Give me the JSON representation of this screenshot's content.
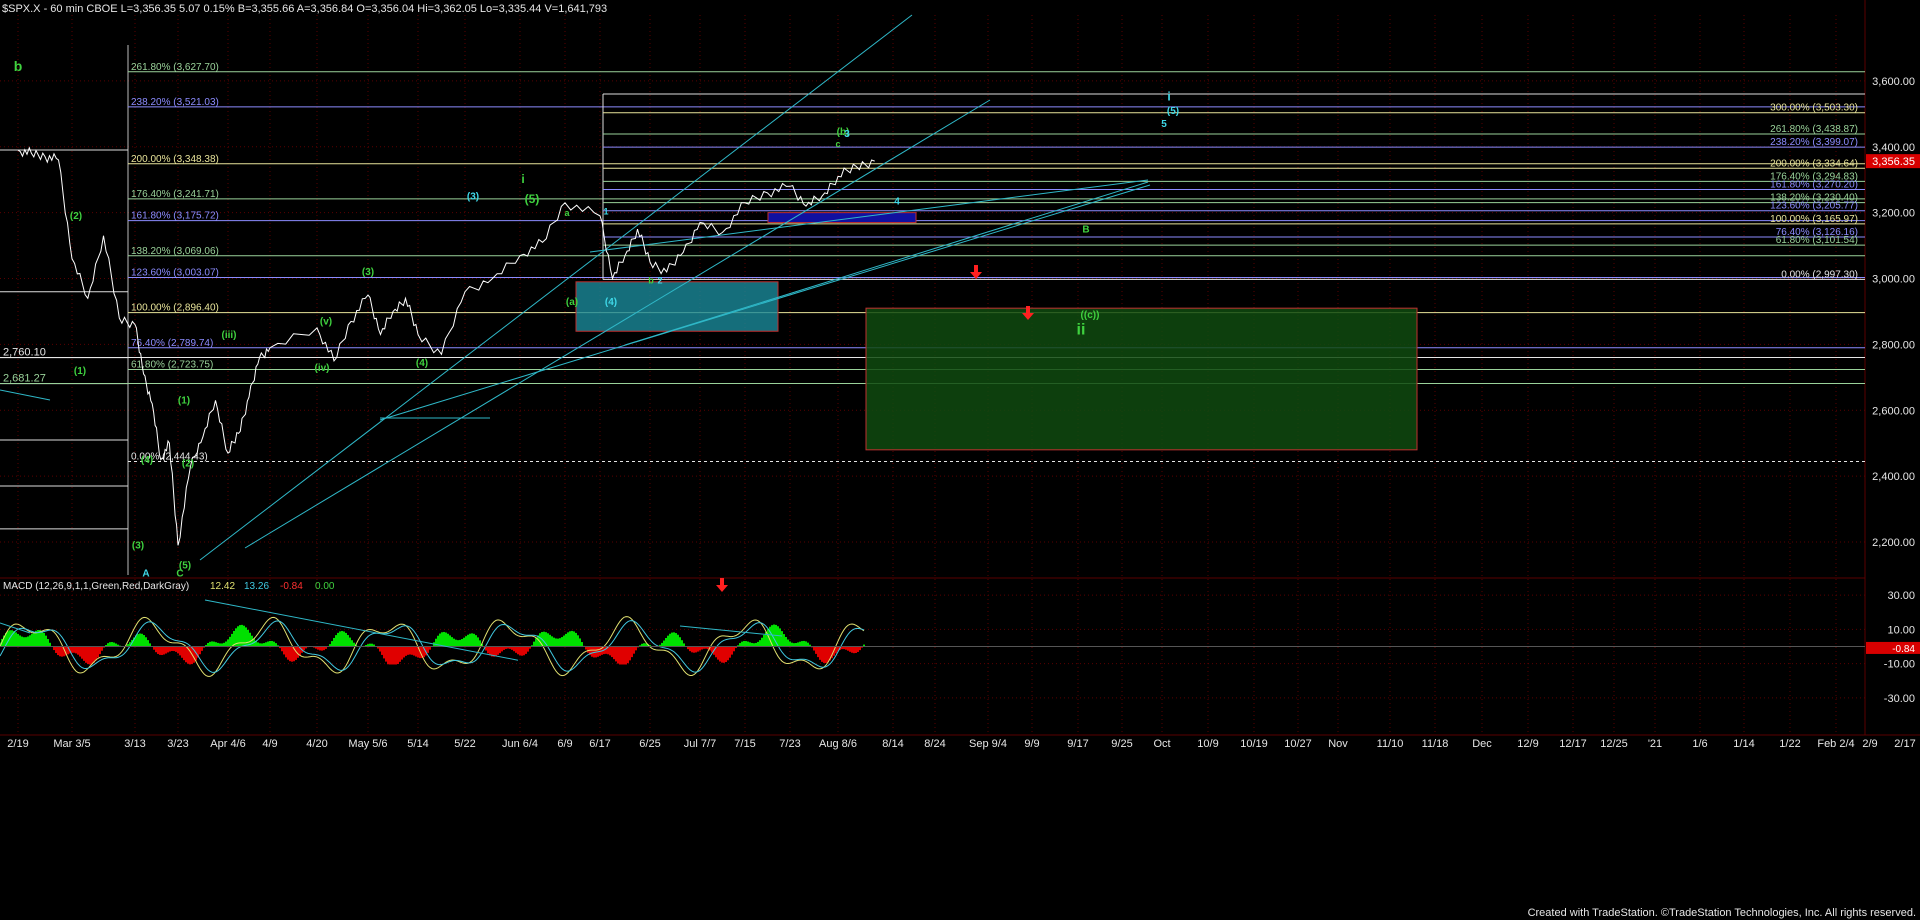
{
  "header": {
    "title": "$SPX.X - 60 min  CBOE  L=3,356.35  5.07  0.15%  B=3,355.66  A=3,356.84  O=3,356.04  Hi=3,362.05  Lo=3,335.44  V=1,641,793"
  },
  "footer": {
    "credit": "Created with TradeStation. ©TradeStation Technologies, Inc. All rights reserved."
  },
  "colors": {
    "background": "#000000",
    "grid": "#5a0000",
    "price": "#ffffff",
    "channel": "#2fb8c8",
    "fib_white": "#e6e6e6",
    "fib_yellow": "#e8e49a",
    "fib_blue": "#8c8cff",
    "fib_green": "#9ad29a",
    "label_green": "#3fd23f",
    "label_cyan": "#3fd8e8",
    "arrow_red": "#ff2020",
    "macd_pos": "#00e000",
    "macd_neg": "#e00000",
    "macd_line": "#e0e070",
    "macd_signal": "#40c8e0",
    "current_price_bg": "#d80000"
  },
  "chart_data": {
    "type": "line",
    "title": "$SPX.X - 60 min",
    "price_axis": {
      "ylim": [
        2100,
        3800
      ],
      "ticks": [
        "3,600.00",
        "3,400.00",
        "3,200.00",
        "3,000.00",
        "2,800.00",
        "2,600.00",
        "2,400.00",
        "2,200.00"
      ],
      "tick_values": [
        3600,
        3400,
        3200,
        3000,
        2800,
        2600,
        2400,
        2200
      ],
      "current_price_label": "3,356.35",
      "current_price": 3356.35
    },
    "x_axis": {
      "labels": [
        "2/19",
        "Mar 3/5",
        "3/13",
        "3/23",
        "Apr 4/6",
        "4/9",
        "4/20",
        "May 5/6",
        "5/14",
        "5/22",
        "Jun 6/4",
        "6/9",
        "6/17",
        "6/25",
        "Jul 7/7",
        "7/15",
        "7/23",
        "Aug 8/6",
        "8/14",
        "8/24",
        "Sep 9/4",
        "9/9",
        "9/17",
        "9/25",
        "Oct",
        "10/9",
        "10/19",
        "10/27",
        "Nov",
        "11/10",
        "11/18",
        "Dec",
        "12/9",
        "12/17",
        "12/25",
        "'21",
        "1/6",
        "1/14",
        "1/22",
        "Feb 2/4",
        "2/9",
        "2/17"
      ]
    },
    "price_series": {
      "name": "SPX 60 min",
      "points": [
        [
          "2/19",
          3390
        ],
        [
          "2/19",
          3380
        ],
        [
          "2/19",
          3370
        ],
        [
          "2/19",
          3360
        ],
        [
          "Mar 3/5",
          3060
        ],
        [
          "Mar 3/5",
          2940
        ],
        [
          "Mar 3/5",
          3130
        ],
        [
          "Mar 3/5",
          2880
        ],
        [
          "3/13",
          2860
        ],
        [
          "3/13",
          2710
        ],
        [
          "3/13",
          2620
        ],
        [
          "3/13",
          2450
        ],
        [
          "3/13",
          2500
        ],
        [
          "3/23",
          2190
        ],
        [
          "3/23",
          2430
        ],
        [
          "3/23",
          2520
        ],
        [
          "3/23",
          2630
        ],
        [
          "Apr 4/6",
          2470
        ],
        [
          "Apr 4/6",
          2530
        ],
        [
          "Apr 4/6",
          2640
        ],
        [
          "Apr 4/6",
          2760
        ],
        [
          "4/9",
          2790
        ],
        [
          "4/20",
          2850
        ],
        [
          "4/20",
          2750
        ],
        [
          "4/20",
          2870
        ],
        [
          "May 5/6",
          2950
        ],
        [
          "May 5/6",
          2830
        ],
        [
          "May 5/6",
          2900
        ],
        [
          "May 5/6",
          2940
        ],
        [
          "5/14",
          2830
        ],
        [
          "5/14",
          2770
        ],
        [
          "5/22",
          2960
        ],
        [
          "5/22",
          3000
        ],
        [
          "Jun 6/4",
          3070
        ],
        [
          "Jun 6/4",
          3110
        ],
        [
          "6/9",
          3230
        ],
        [
          "6/17",
          3190
        ],
        [
          "6/17",
          3000
        ],
        [
          "6/17",
          3070
        ],
        [
          "6/17",
          3150
        ],
        [
          "6/25",
          3050
        ],
        [
          "6/25",
          3020
        ],
        [
          "6/25",
          3080
        ],
        [
          "Jul 7/7",
          3170
        ],
        [
          "Jul 7/7",
          3140
        ],
        [
          "7/15",
          3230
        ],
        [
          "7/15",
          3260
        ],
        [
          "7/23",
          3280
        ],
        [
          "7/23",
          3220
        ],
        [
          "7/23",
          3250
        ],
        [
          "Aug 8/6",
          3310
        ],
        [
          "Aug 8/6",
          3340
        ],
        [
          "Aug 8/6",
          3356.35
        ]
      ]
    },
    "fib_left": [
      {
        "label": "261.80% (3,627.70)",
        "value": 3627.7,
        "color": "#9ad29a"
      },
      {
        "label": "238.20% (3,521.03)",
        "value": 3521.03,
        "color": "#8c8cff"
      },
      {
        "label": "200.00% (3,348.38)",
        "value": 3348.38,
        "color": "#e8e49a"
      },
      {
        "label": "176.40% (3,241.71)",
        "value": 3241.71,
        "color": "#9ad29a"
      },
      {
        "label": "161.80% (3,175.72)",
        "value": 3175.72,
        "color": "#8c8cff"
      },
      {
        "label": "138.20% (3,069.06)",
        "value": 3069.06,
        "color": "#9ad29a"
      },
      {
        "label": "123.60% (3,003.07)",
        "value": 3003.07,
        "color": "#8c8cff"
      },
      {
        "label": "100.00% (2,896.40)",
        "value": 2896.4,
        "color": "#e8e49a"
      },
      {
        "label": "76.40% (2,789.74)",
        "value": 2789.74,
        "color": "#8c8cff"
      },
      {
        "label": "61.80% (2,723.75)",
        "value": 2723.75,
        "color": "#9ad29a"
      },
      {
        "label": "0.00% (2,444.43)",
        "value": 2444.43,
        "color": "#e6e6e6"
      }
    ],
    "fib_right": [
      {
        "label": "300.00% (3,503.30)",
        "value": 3503.3,
        "color": "#e8e49a"
      },
      {
        "label": "261.80% (3,438.87)",
        "value": 3438.87,
        "color": "#9ad29a"
      },
      {
        "label": "238.20% (3,399.07)",
        "value": 3399.07,
        "color": "#8c8cff"
      },
      {
        "label": "200.00% (3,334.64)",
        "value": 3334.64,
        "color": "#e8e49a"
      },
      {
        "label": "176.40% (3,294.83)",
        "value": 3294.83,
        "color": "#9ad29a"
      },
      {
        "label": "161.80% (3,270.20)",
        "value": 3270.2,
        "color": "#8c8cff"
      },
      {
        "label": "138.20% (3,230.40)",
        "value": 3230.4,
        "color": "#9ad29a"
      },
      {
        "label": "123.60% (3,205.77)",
        "value": 3205.77,
        "color": "#8c8cff"
      },
      {
        "label": "100.00% (3,165.97)",
        "value": 3165.97,
        "color": "#e8e49a"
      },
      {
        "label": "76.40% (3,126.16)",
        "value": 3126.16,
        "color": "#8c8cff"
      },
      {
        "label": "61.80% (3,101.54)",
        "value": 3101.54,
        "color": "#9ad29a"
      },
      {
        "label": "0.00% (2,997.30)",
        "value": 2997.3,
        "color": "#e6e6e6"
      }
    ],
    "level_labels": [
      {
        "label": "2,760.10",
        "value": 2760.1,
        "color": "#e6e6e6"
      },
      {
        "label": "2,681.27",
        "value": 2681.27,
        "color": "#9ad29a"
      }
    ],
    "wave_labels": [
      {
        "text": "b",
        "x": "2/19",
        "value": 3630,
        "color": "#3fd23f",
        "size": 14
      },
      {
        "text": "(2)",
        "x": "Mar 3/5",
        "value": 3180,
        "color": "#3fd23f",
        "size": 10
      },
      {
        "text": "(1)",
        "x": "Mar 3/5",
        "value": 2710,
        "color": "#3fd23f",
        "size": 10
      },
      {
        "text": "(4)",
        "x": "3/13",
        "value": 2440,
        "color": "#3fd23f",
        "size": 10
      },
      {
        "text": "(3)",
        "x": "3/13",
        "value": 2180,
        "color": "#3fd23f",
        "size": 10
      },
      {
        "text": "(5)",
        "x": "3/23",
        "value": 2120,
        "color": "#3fd23f",
        "size": 10
      },
      {
        "text": "A",
        "x": "3/13",
        "value": 2095,
        "color": "#3fd8e8",
        "size": 10
      },
      {
        "text": "C",
        "x": "3/23",
        "value": 2095,
        "color": "#3fd23f",
        "size": 10
      },
      {
        "text": "(1)",
        "x": "3/23",
        "value": 2620,
        "color": "#3fd23f",
        "size": 10
      },
      {
        "text": "(2)",
        "x": "3/23",
        "value": 2430,
        "color": "#3fd23f",
        "size": 10
      },
      {
        "text": "(iii)",
        "x": "Apr 4/6",
        "value": 2820,
        "color": "#3fd23f",
        "size": 10
      },
      {
        "text": "(iv)",
        "x": "4/20",
        "value": 2720,
        "color": "#3fd23f",
        "size": 10
      },
      {
        "text": "(v)",
        "x": "4/20",
        "value": 2860,
        "color": "#3fd23f",
        "size": 10
      },
      {
        "text": "(3)",
        "x": "May 5/6",
        "value": 3010,
        "color": "#3fd23f",
        "size": 10
      },
      {
        "text": "(4)",
        "x": "5/14",
        "value": 2735,
        "color": "#3fd23f",
        "size": 10
      },
      {
        "text": "(3)",
        "x": "5/22",
        "value": 3240,
        "color": "#3fd8e8",
        "size": 10
      },
      {
        "text": "(5)",
        "x": "Jun 6/4",
        "value": 3230,
        "color": "#3fd23f",
        "size": 12
      },
      {
        "text": "i",
        "x": "Jun 6/4",
        "value": 3290,
        "color": "#3fd23f",
        "size": 12
      },
      {
        "text": "(a)",
        "x": "6/9",
        "value": 2920,
        "color": "#3fd23f",
        "size": 10
      },
      {
        "text": "(4)",
        "x": "6/17",
        "value": 2920,
        "color": "#3fd8e8",
        "size": 10
      },
      {
        "text": "a",
        "x": "6/9",
        "value": 3190,
        "color": "#3fd23f",
        "size": 9
      },
      {
        "text": "1",
        "x": "6/17",
        "value": 3195,
        "color": "#3fd8e8",
        "size": 9
      },
      {
        "text": "2",
        "x": "6/25",
        "value": 2985,
        "color": "#3fd8e8",
        "size": 9
      },
      {
        "text": "b",
        "x": "6/25",
        "value": 2985,
        "color": "#3fd23f",
        "size": 9
      },
      {
        "text": "(b)",
        "x": "Aug 8/6",
        "value": 3435,
        "color": "#3fd23f",
        "size": 10
      },
      {
        "text": "3",
        "x": "Aug 8/6",
        "value": 3430,
        "color": "#3fd8e8",
        "size": 10
      },
      {
        "text": "c",
        "x": "Aug 8/6",
        "value": 3400,
        "color": "#3fd23f",
        "size": 9
      },
      {
        "text": "4",
        "x": "8/14",
        "value": 3225,
        "color": "#3fd8e8",
        "size": 10
      },
      {
        "text": "B",
        "x": "9/17",
        "value": 3140,
        "color": "#3fd23f",
        "size": 10
      },
      {
        "text": "((c))",
        "x": "9/17",
        "value": 2880,
        "color": "#3fd23f",
        "size": 10
      },
      {
        "text": "ii",
        "x": "9/17",
        "value": 2830,
        "color": "#3fd23f",
        "size": 16
      },
      {
        "text": "i",
        "x": "Oct",
        "value": 3540,
        "color": "#3fd8e8",
        "size": 12
      },
      {
        "text": "(5)",
        "x": "Oct",
        "value": 3500,
        "color": "#3fd8e8",
        "size": 10
      },
      {
        "text": "5",
        "x": "Oct",
        "value": 3460,
        "color": "#3fd8e8",
        "size": 10
      }
    ],
    "macd": {
      "label": "MACD (12,26,9,1,1,Green,Red,DarkGray)",
      "values_text": [
        "12.42",
        "13.26",
        "-0.84",
        "0.00"
      ],
      "value_colors": [
        "#e0e070",
        "#40c8e0",
        "#ff3030",
        "#3fd23f"
      ],
      "ticks": [
        "30.00",
        "10.00",
        "-10.00",
        "-30.00"
      ],
      "tick_values": [
        30,
        10,
        -10,
        -30
      ],
      "current_label": "-0.84",
      "current_value": -0.84,
      "ylim": [
        -40,
        40
      ]
    }
  }
}
